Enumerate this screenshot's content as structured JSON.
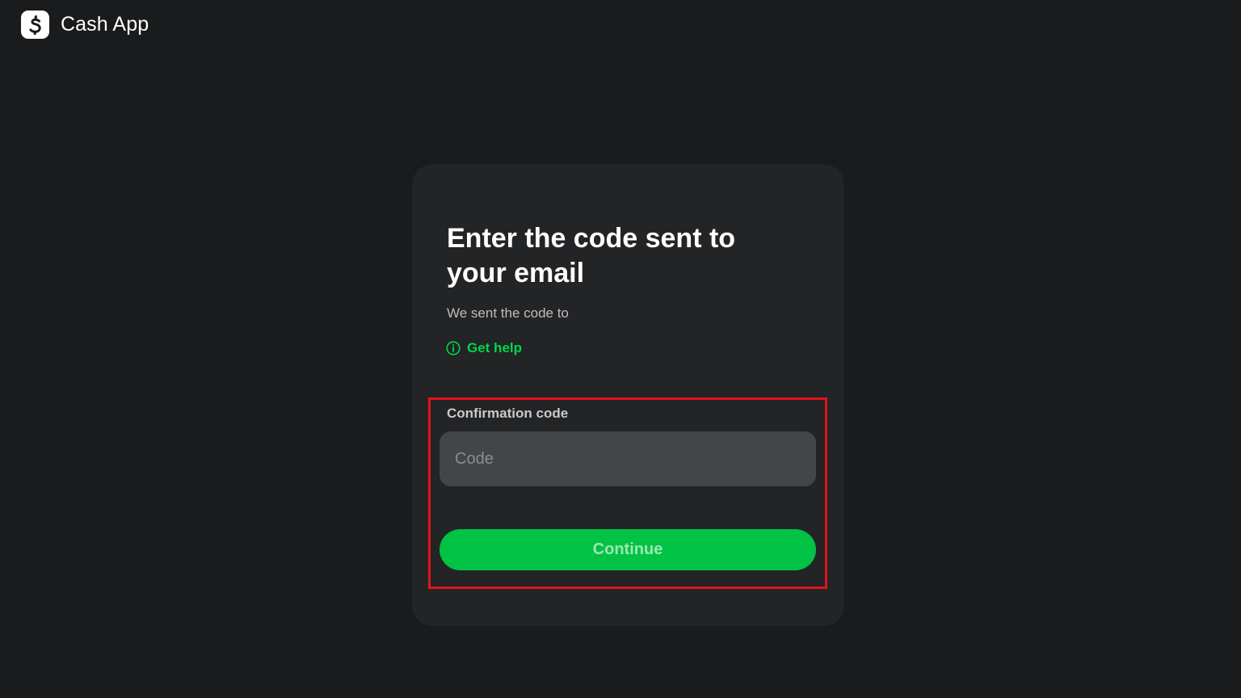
{
  "header": {
    "brand_name": "Cash App",
    "logo_icon": "dollar-sign-icon"
  },
  "card": {
    "title": "Enter the code sent to your email",
    "subtitle": "We sent the code to",
    "help_link": {
      "icon": "info-circle-icon",
      "label": "Get help"
    },
    "code_field": {
      "label": "Confirmation code",
      "placeholder": "Code",
      "value": ""
    },
    "continue_label": "Continue"
  },
  "colors": {
    "background": "#1a1b1d",
    "card": "#232426",
    "accent_green": "#00c244",
    "link_green": "#00d54b",
    "highlight_red": "#e0141b"
  }
}
